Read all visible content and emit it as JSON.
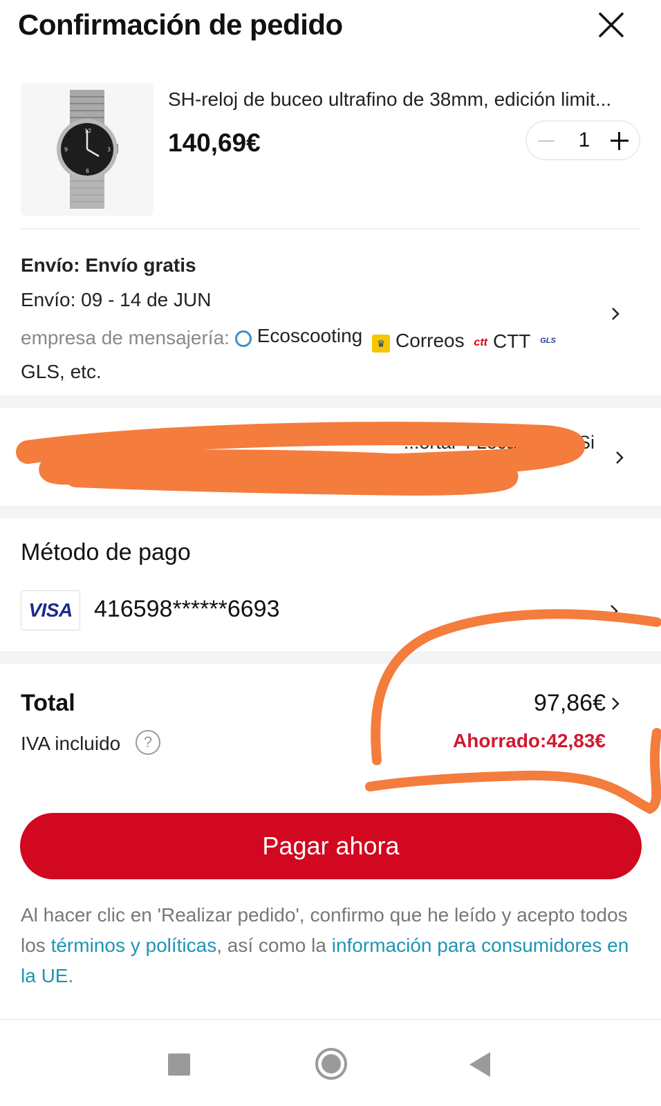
{
  "header": {
    "title": "Confirmación de pedido"
  },
  "product": {
    "name": "SH-reloj de buceo ultrafino de 38mm, edición limit...",
    "price": "140,69€",
    "quantity": "1"
  },
  "shipping": {
    "title": "Envío: Envío gratis",
    "date": "Envío: 09 - 14 de JUN",
    "couriers_label": "empresa de mensajería:",
    "couriers": [
      "Ecoscooting",
      "Correos",
      "CTT"
    ],
    "couriers_more": "GLS, etc."
  },
  "address": {
    "visible_fragment_1": "...a.. Si",
    "visible_fragment_2": "...ortal 4 Local..."
  },
  "payment": {
    "title": "Método de pago",
    "card_brand": "VISA",
    "card_number": "416598******6693"
  },
  "total": {
    "label": "Total",
    "amount": "97,86€",
    "tax_note": "IVA incluido",
    "saved": "Ahorrado:42,83€"
  },
  "pay_button": {
    "label": "Pagar ahora"
  },
  "legal": {
    "text_1": "Al hacer clic en 'Realizar pedido', confirmo que he leído y acepto todos los ",
    "link_terms": "términos y políticas",
    "text_2": ", así como la ",
    "link_eu": "información para consumidores en la UE",
    "text_3": "."
  },
  "icons": {
    "close": "close-icon",
    "chevron": "chevron-right-icon",
    "help": "help-icon"
  },
  "colors": {
    "accent": "#d1081f",
    "saved": "#d0182f",
    "link": "#1f93b5",
    "annotation": "#f47c3c"
  }
}
